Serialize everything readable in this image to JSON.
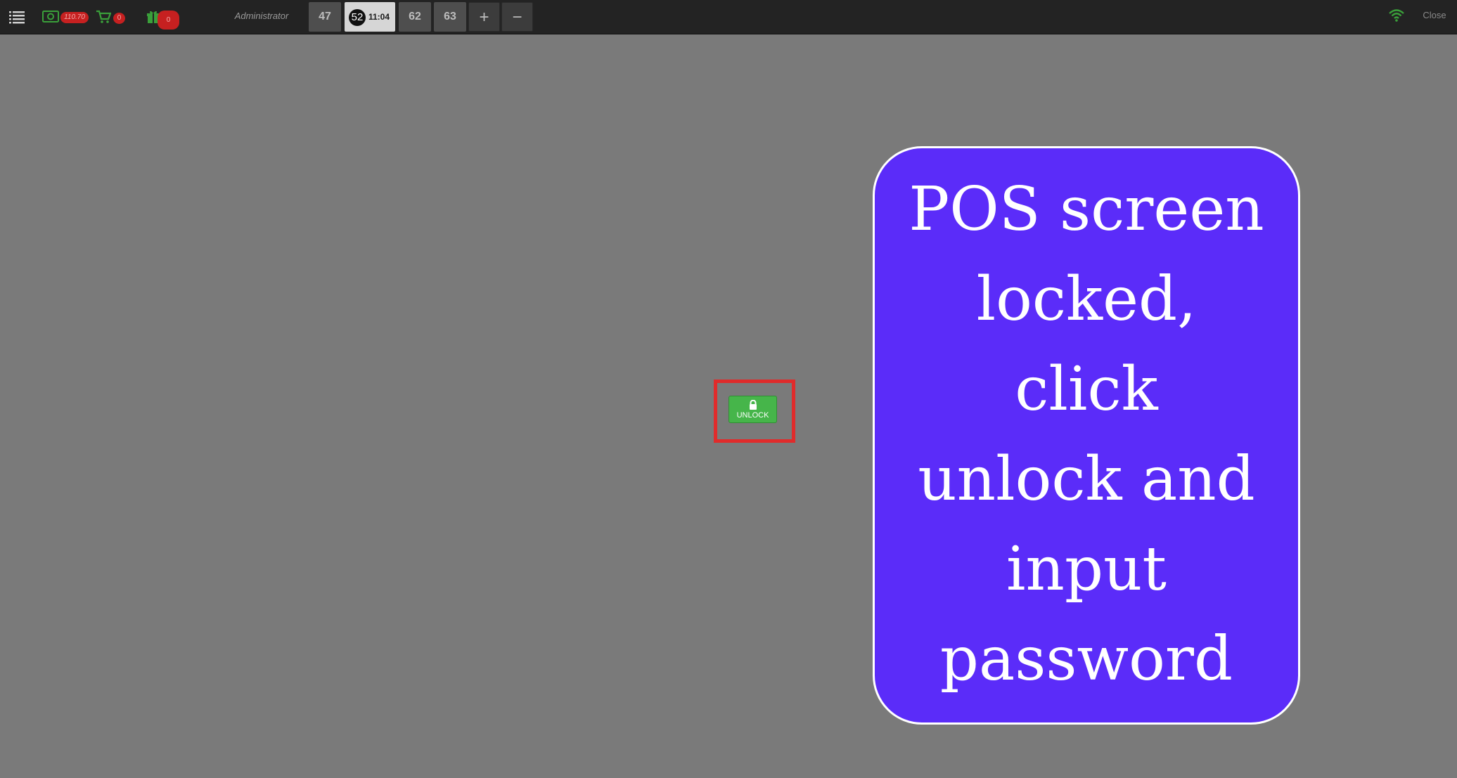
{
  "topbar": {
    "menu_icon": "list-menu-icon",
    "cash": {
      "icon": "cash-icon",
      "badge": "110.70"
    },
    "cart": {
      "icon": "cart-icon",
      "badge": "0"
    },
    "gift": {
      "icon": "gift-icon",
      "badge": "0"
    },
    "user_label": "Administrator",
    "tabs": [
      {
        "label": "47"
      },
      {
        "label": "52",
        "time": "11:04",
        "active": true
      },
      {
        "label": "62"
      },
      {
        "label": "63"
      }
    ],
    "add_tab_label": "+",
    "remove_tab_label": "−",
    "wifi_icon": "wifi-icon",
    "close_label": "Close"
  },
  "lock_screen": {
    "unlock_label": "UNLOCK",
    "lock_icon": "lock-icon"
  },
  "annotation": {
    "text": "POS screen locked, click unlock and input password"
  },
  "colors": {
    "topbar_bg": "#232323",
    "screen_bg": "#7a7a7a",
    "badge_red": "#c62020",
    "unlock_green": "#46b54a",
    "highlight_red": "#e02b2b",
    "card_purple": "#5b2cf9",
    "icon_green": "#3aa03a"
  }
}
